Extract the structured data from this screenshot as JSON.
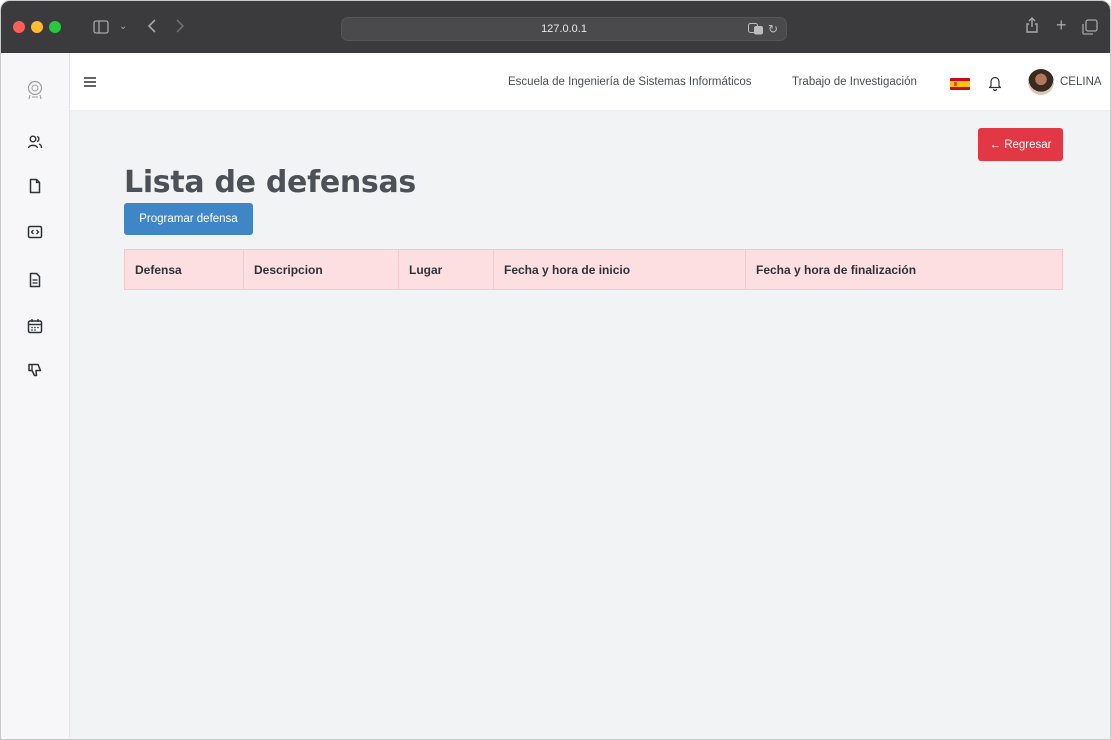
{
  "browser": {
    "url": "127.0.0.1"
  },
  "navbar": {
    "links": [
      "Escuela de Ingeniería de Sistemas Informáticos",
      "Trabajo de Investigación"
    ],
    "language_flag": "spain-flag-icon",
    "user_name": "CELINA"
  },
  "sidebar": {
    "icons": [
      "users-icon",
      "document-icon",
      "code-icon",
      "file-text-icon",
      "calendar-icon",
      "thumbs-down-icon"
    ]
  },
  "main": {
    "back_button": "← Regresar",
    "title": "Lista de defensas",
    "schedule_button": "Programar defensa",
    "table": {
      "columns": [
        "Defensa",
        "Descripcion",
        "Lugar",
        "Fecha y hora de inicio",
        "Fecha y hora de finalización"
      ],
      "rows": []
    }
  },
  "colors": {
    "accent_primary": "#3f86c7",
    "accent_danger": "#e23744",
    "table_header_bg": "#fddfe2"
  }
}
